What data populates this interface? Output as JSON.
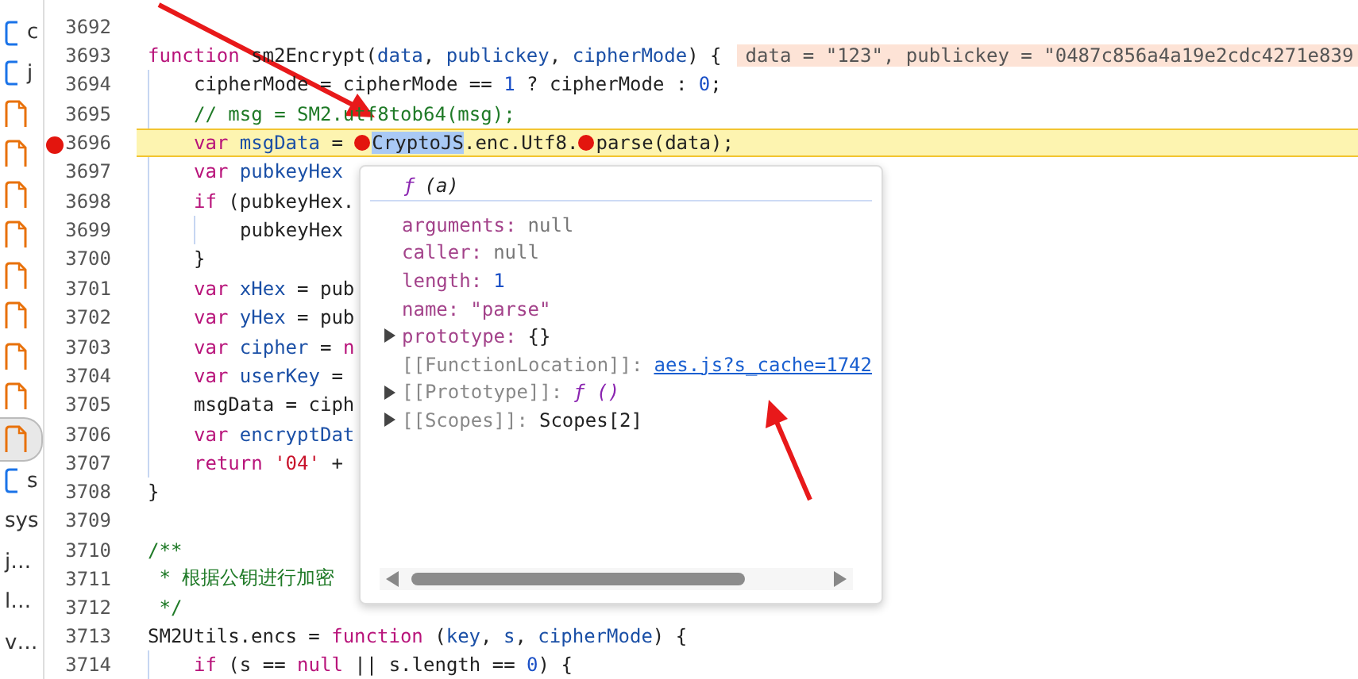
{
  "sidebar": {
    "items": [
      {
        "kind": "script",
        "label": "c",
        "selected": false
      },
      {
        "kind": "script",
        "label": "j",
        "selected": false
      },
      {
        "kind": "file",
        "selected": false
      },
      {
        "kind": "file",
        "selected": false
      },
      {
        "kind": "file",
        "selected": false
      },
      {
        "kind": "file",
        "selected": false
      },
      {
        "kind": "file",
        "selected": false
      },
      {
        "kind": "file",
        "selected": false
      },
      {
        "kind": "file",
        "selected": false
      },
      {
        "kind": "file",
        "selected": false
      },
      {
        "kind": "file",
        "selected": true
      },
      {
        "kind": "script",
        "label": "s",
        "selected": false
      },
      {
        "kind": "text",
        "label": "sys",
        "selected": false
      },
      {
        "kind": "text",
        "label": "j…",
        "selected": false
      },
      {
        "kind": "text",
        "label": "l…",
        "selected": false
      },
      {
        "kind": "text",
        "label": "v…",
        "selected": false
      }
    ]
  },
  "editor": {
    "lines": [
      {
        "number": "3692",
        "kind": "top",
        "current": false,
        "breakpoint": false
      },
      {
        "number": "3693",
        "kind": "top",
        "current": false,
        "breakpoint": false,
        "tokens": [
          {
            "kind": "keyword",
            "text": "function"
          },
          {
            "kind": "plain",
            "text": " sm2Encrypt("
          },
          {
            "kind": "def",
            "text": "data"
          },
          {
            "kind": "plain",
            "text": ", "
          },
          {
            "kind": "def",
            "text": "publickey"
          },
          {
            "kind": "plain",
            "text": ", "
          },
          {
            "kind": "def",
            "text": "cipherMode"
          },
          {
            "kind": "plain",
            "text": ") {"
          }
        ],
        "hint": "data = \"123\", publickey = \"0487c856a4a19e2cdc4271e839"
      },
      {
        "number": "3694",
        "kind": "block",
        "current": false,
        "breakpoint": false,
        "tokens": [
          {
            "kind": "plain",
            "text": "cipherMode = cipherMode == "
          },
          {
            "kind": "number",
            "text": "1"
          },
          {
            "kind": "plain",
            "text": " ? cipherMode : "
          },
          {
            "kind": "number",
            "text": "0"
          },
          {
            "kind": "plain",
            "text": ";"
          }
        ]
      },
      {
        "number": "3695",
        "kind": "block",
        "current": false,
        "breakpoint": false,
        "tokens": [
          {
            "kind": "comment",
            "text": "// msg = SM2.utf8tob64(msg);"
          }
        ]
      },
      {
        "number": "3696",
        "kind": "block",
        "current": true,
        "breakpoint": true,
        "tokens": [
          {
            "kind": "keyword",
            "text": "var "
          },
          {
            "kind": "def",
            "text": "msgData"
          },
          {
            "kind": "plain",
            "text": " = "
          },
          {
            "kind": "marker"
          },
          {
            "kind": "selected",
            "text": "CryptoJS"
          },
          {
            "kind": "plain",
            "text": ".enc.Utf8."
          },
          {
            "kind": "marker"
          },
          {
            "kind": "plain",
            "text": "parse(data);"
          }
        ]
      },
      {
        "number": "3697",
        "kind": "block",
        "current": false,
        "breakpoint": false,
        "tokens": [
          {
            "kind": "keyword",
            "text": "var "
          },
          {
            "kind": "def",
            "text": "pubkeyHex"
          }
        ]
      },
      {
        "number": "3698",
        "kind": "block",
        "current": false,
        "breakpoint": false,
        "tokens": [
          {
            "kind": "keyword",
            "text": "if"
          },
          {
            "kind": "plain",
            "text": " (pubkeyHex."
          }
        ]
      },
      {
        "number": "3699",
        "kind": "nested",
        "current": false,
        "breakpoint": false,
        "tokens": [
          {
            "kind": "plain",
            "text": "pubkeyHex"
          }
        ]
      },
      {
        "number": "3700",
        "kind": "block",
        "current": false,
        "breakpoint": false,
        "tokens": [
          {
            "kind": "plain",
            "text": "}"
          }
        ]
      },
      {
        "number": "3701",
        "kind": "block",
        "current": false,
        "breakpoint": false,
        "tokens": [
          {
            "kind": "keyword",
            "text": "var "
          },
          {
            "kind": "def",
            "text": "xHex"
          },
          {
            "kind": "plain",
            "text": " = pub"
          }
        ]
      },
      {
        "number": "3702",
        "kind": "block",
        "current": false,
        "breakpoint": false,
        "tokens": [
          {
            "kind": "keyword",
            "text": "var "
          },
          {
            "kind": "def",
            "text": "yHex"
          },
          {
            "kind": "plain",
            "text": " = pub"
          }
        ]
      },
      {
        "number": "3703",
        "kind": "block",
        "current": false,
        "breakpoint": false,
        "tokens": [
          {
            "kind": "keyword",
            "text": "var "
          },
          {
            "kind": "def",
            "text": "cipher"
          },
          {
            "kind": "plain",
            "text": " = "
          },
          {
            "kind": "keyword",
            "text": "n"
          }
        ]
      },
      {
        "number": "3704",
        "kind": "block",
        "current": false,
        "breakpoint": false,
        "tokens": [
          {
            "kind": "keyword",
            "text": "var "
          },
          {
            "kind": "def",
            "text": "userKey"
          },
          {
            "kind": "plain",
            "text": " ="
          }
        ]
      },
      {
        "number": "3705",
        "kind": "block",
        "current": false,
        "breakpoint": false,
        "tokens": [
          {
            "kind": "plain",
            "text": "msgData = ciph"
          }
        ]
      },
      {
        "number": "3706",
        "kind": "block",
        "current": false,
        "breakpoint": false,
        "tokens": [
          {
            "kind": "keyword",
            "text": "var "
          },
          {
            "kind": "def",
            "text": "encryptDat"
          }
        ]
      },
      {
        "number": "3707",
        "kind": "block",
        "current": false,
        "breakpoint": false,
        "tokens": [
          {
            "kind": "keyword",
            "text": "return "
          },
          {
            "kind": "string",
            "text": "'04'"
          },
          {
            "kind": "plain",
            "text": " +"
          }
        ]
      },
      {
        "number": "3708",
        "kind": "top",
        "current": false,
        "breakpoint": false,
        "tokens": [
          {
            "kind": "plain",
            "text": "}"
          }
        ]
      },
      {
        "number": "3709",
        "kind": "top",
        "current": false,
        "breakpoint": false
      },
      {
        "number": "3710",
        "kind": "top",
        "current": false,
        "breakpoint": false,
        "tokens": [
          {
            "kind": "comment",
            "text": "/**"
          }
        ]
      },
      {
        "number": "3711",
        "kind": "top",
        "current": false,
        "breakpoint": false,
        "tokens": [
          {
            "kind": "comment",
            "text": " * 根据公钥进行加密"
          }
        ]
      },
      {
        "number": "3712",
        "kind": "top",
        "current": false,
        "breakpoint": false,
        "tokens": [
          {
            "kind": "comment",
            "text": " */"
          }
        ]
      },
      {
        "number": "3713",
        "kind": "top",
        "current": false,
        "breakpoint": false,
        "tokens": [
          {
            "kind": "plain",
            "text": "SM2Utils.encs = "
          },
          {
            "kind": "keyword",
            "text": "function"
          },
          {
            "kind": "plain",
            "text": " ("
          },
          {
            "kind": "def",
            "text": "key"
          },
          {
            "kind": "plain",
            "text": ", "
          },
          {
            "kind": "def",
            "text": "s"
          },
          {
            "kind": "plain",
            "text": ", "
          },
          {
            "kind": "def",
            "text": "cipherMode"
          },
          {
            "kind": "plain",
            "text": ") {"
          }
        ]
      },
      {
        "number": "3714",
        "kind": "block",
        "current": false,
        "breakpoint": false,
        "tokens": [
          {
            "kind": "keyword",
            "text": "if"
          },
          {
            "kind": "plain",
            "text": " (s == "
          },
          {
            "kind": "keyword",
            "text": "null"
          },
          {
            "kind": "plain",
            "text": " || s.length == "
          },
          {
            "kind": "number",
            "text": "0"
          },
          {
            "kind": "plain",
            "text": ") {"
          }
        ]
      }
    ]
  },
  "popover": {
    "icon": "ƒ",
    "params": "(a)",
    "properties": [
      {
        "name": "arguments:",
        "kind": "own",
        "expandable": false,
        "value": {
          "kind": "null",
          "text": "null"
        }
      },
      {
        "name": "caller:",
        "kind": "own",
        "expandable": false,
        "value": {
          "kind": "null",
          "text": "null"
        }
      },
      {
        "name": "length:",
        "kind": "own",
        "expandable": false,
        "value": {
          "kind": "number",
          "text": "1"
        }
      },
      {
        "name": "name:",
        "kind": "own",
        "expandable": false,
        "value": {
          "kind": "string",
          "text": "\"parse\""
        }
      },
      {
        "name": "prototype:",
        "kind": "own",
        "expandable": true,
        "value": {
          "kind": "plain",
          "text": "{}"
        }
      },
      {
        "name": "[[FunctionLocation]]:",
        "kind": "internal",
        "expandable": false,
        "value": {
          "kind": "link",
          "text": "aes.js?s_cache=1742"
        }
      },
      {
        "name": "[[Prototype]]:",
        "kind": "internal",
        "expandable": true,
        "value": {
          "kind": "function",
          "text": "ƒ ()"
        }
      },
      {
        "name": "[[Scopes]]:",
        "kind": "internal",
        "expandable": true,
        "value": {
          "kind": "plain",
          "text": "Scopes[2]"
        }
      }
    ]
  }
}
